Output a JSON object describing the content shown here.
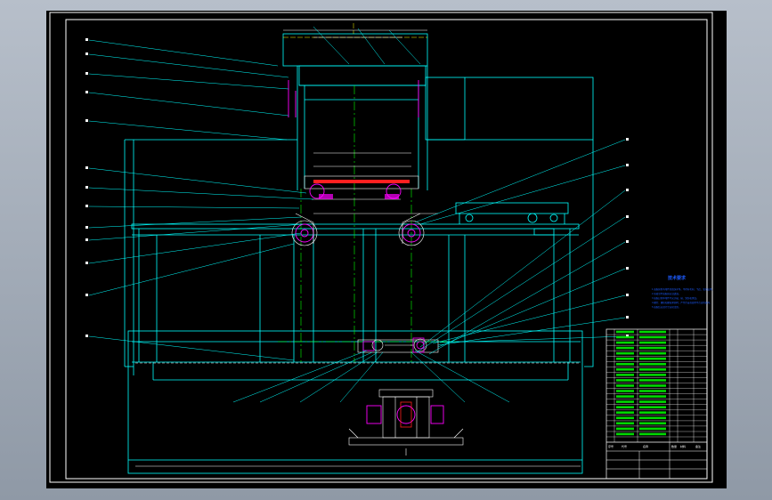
{
  "app": {
    "title": ""
  },
  "technical_requirements": {
    "title": "技术要求",
    "lines": [
      "1.装配前所有零件须清洗干净，不得有毛刺、飞边、氧化皮等。",
      "2.各密封件装配前应浸透油。",
      "3.装配过程中零件不允许磕、碰、划伤和锈蚀。",
      "4.螺钉、螺栓和螺母紧固时，严禁打击或使用不合适的旋具。",
      "5.装配后应进行空运转试验。"
    ]
  },
  "title_block": {
    "header": [
      "序号",
      "代号",
      "名称",
      "数量",
      "材料",
      "备注"
    ]
  },
  "colors": {
    "frame": "#00ffff",
    "inner_frame": "#ffffff",
    "leader": "#00ffff",
    "center": "#00ff00",
    "magenta": "#ff00ff",
    "yellow": "#ffff00",
    "red": "#ff2020",
    "blue_text": "#1d5cff"
  }
}
